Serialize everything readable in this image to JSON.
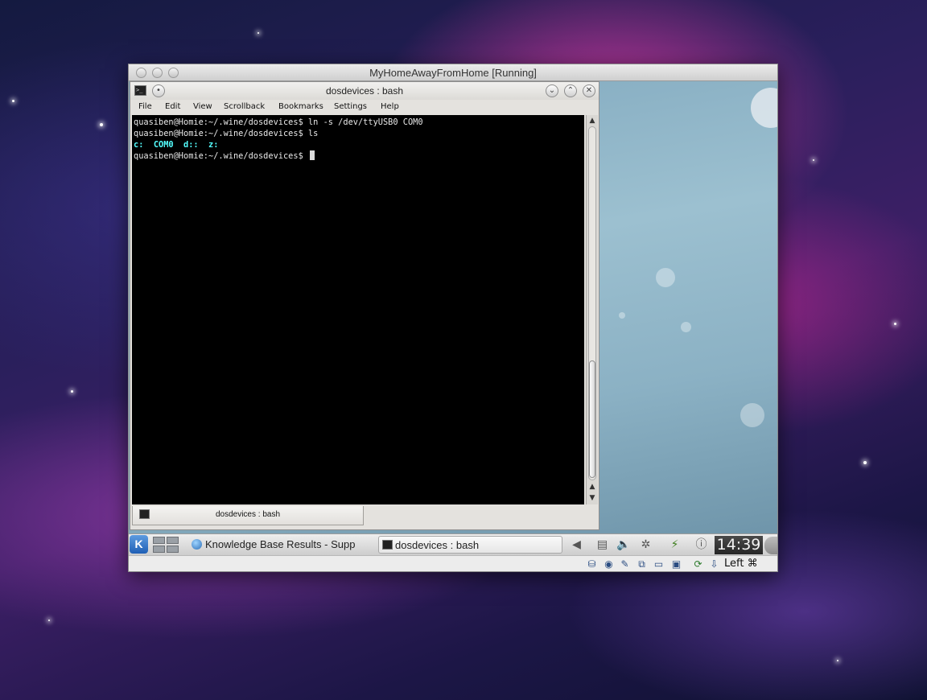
{
  "vbox": {
    "title": "MyHomeAwayFromHome [Running]",
    "host_key": "Left ⌘"
  },
  "konsole": {
    "title": "dosdevices : bash",
    "menu": [
      "File",
      "Edit",
      "View",
      "Scrollback",
      "Bookmarks",
      "Settings",
      "Help"
    ],
    "lines": [
      "quasiben@Homie:~/.wine/dosdevices$ ln -s /dev/ttyUSB0 COM0",
      "quasiben@Homie:~/.wine/dosdevices$ ls"
    ],
    "ls_output": [
      "c:",
      "COM0",
      "d::",
      "z:"
    ],
    "prompt": "quasiben@Homie:~/.wine/dosdevices$ ",
    "session_tab": "dosdevices : bash"
  },
  "panel": {
    "kmenu_label": "K",
    "tasks": [
      "Knowledge Base Results - Supp",
      "dosdevices : bash"
    ],
    "clock": "14:39"
  }
}
